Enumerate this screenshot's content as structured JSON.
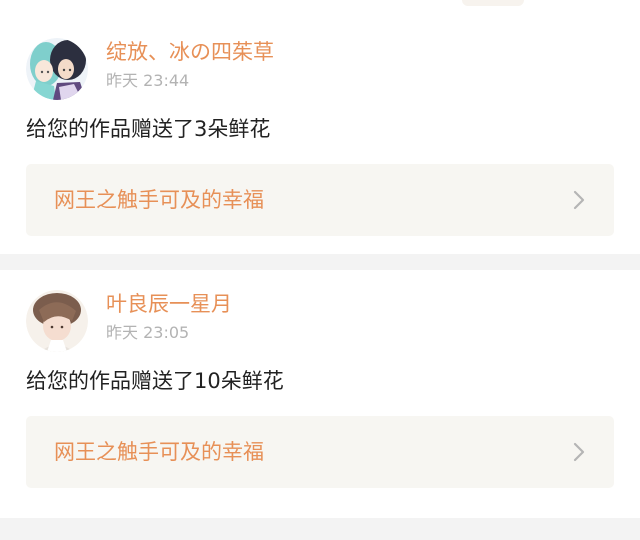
{
  "notifications": [
    {
      "username": "绽放、冰の四茱草",
      "time": "昨天 23:44",
      "message": "给您的作品赠送了3朵鲜花",
      "work_title": "网王之触手可及的幸福",
      "avatar_icon": "anime-couple-avatar",
      "chevron_icon": "chevron-right-icon"
    },
    {
      "username": "叶良辰一星月",
      "time": "昨天 23:05",
      "message": "给您的作品赠送了10朵鲜花",
      "work_title": "网王之触手可及的幸福",
      "avatar_icon": "anime-boy-avatar",
      "chevron_icon": "chevron-right-icon"
    }
  ],
  "colors": {
    "accent": "#e79057",
    "text": "#222222",
    "muted": "#b3b3b3",
    "card_bg": "#ffffff",
    "page_bg": "#f3f3f3",
    "link_bg": "#f7f6f2"
  }
}
